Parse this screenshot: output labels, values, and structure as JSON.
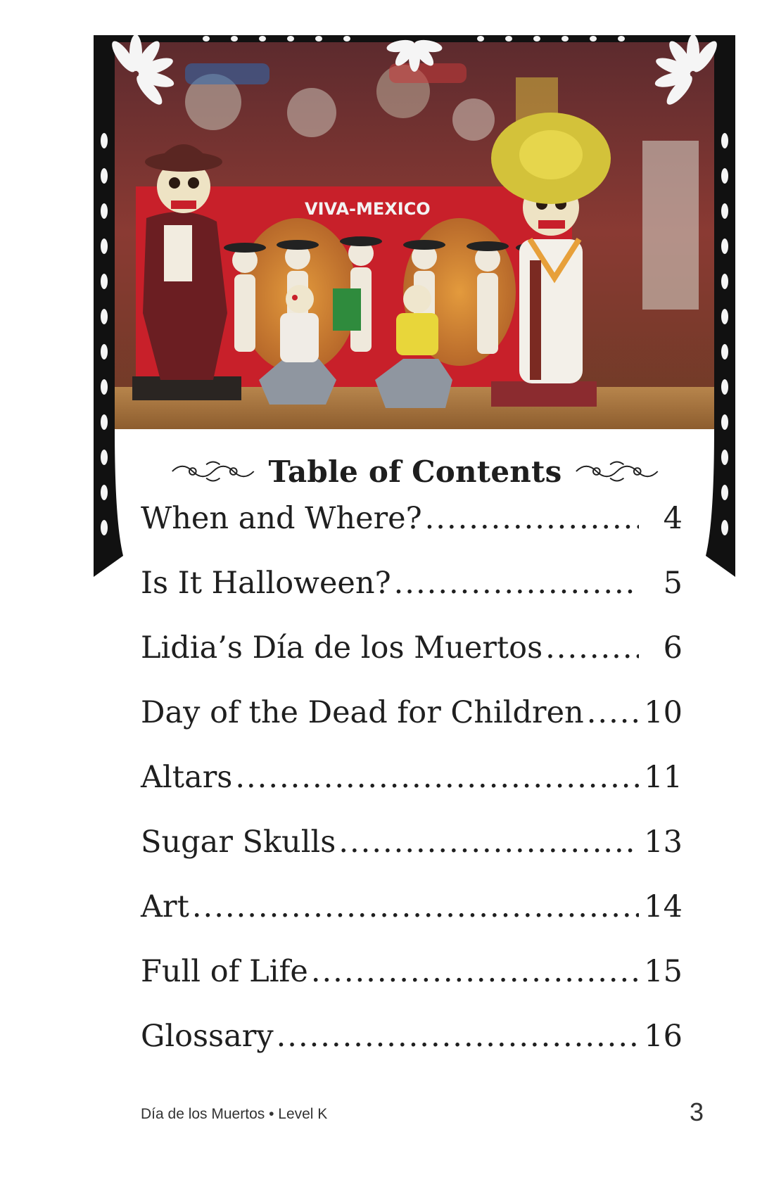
{
  "toc": {
    "heading": "Table of Contents",
    "entries": [
      {
        "title": "When and Where?",
        "page": "4"
      },
      {
        "title": "Is It Halloween?",
        "page": "5"
      },
      {
        "title": "Lidia’s Día de los Muertos",
        "page": "6"
      },
      {
        "title": "Day of the Dead for Children",
        "page": "10"
      },
      {
        "title": "Altars",
        "page": "11"
      },
      {
        "title": "Sugar Skulls",
        "page": "13"
      },
      {
        "title": "Art",
        "page": "14"
      },
      {
        "title": "Full of Life",
        "page": "15"
      },
      {
        "title": "Glossary",
        "page": "16"
      }
    ]
  },
  "photo": {
    "sign_text": "VIVA-MEXICO"
  },
  "footer": {
    "book_info": "Día de los Muertos • Level K",
    "page_number": "3"
  },
  "colors": {
    "frame": "#111111",
    "sign_red": "#c8202a",
    "text": "#1f1f1f"
  },
  "icons": {
    "heading_ornament": "scroll-flourish-icon",
    "frame_decoration": "papel-picado-border"
  }
}
